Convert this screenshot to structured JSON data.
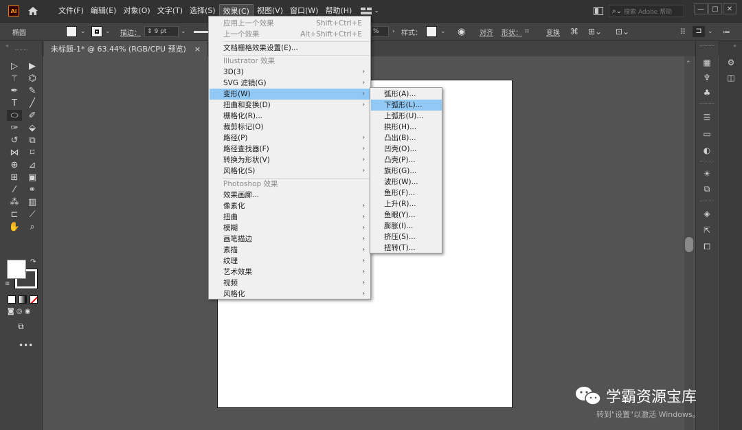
{
  "app": {
    "logo_text": "Ai"
  },
  "menubar": {
    "items": [
      "文件(F)",
      "编辑(E)",
      "对象(O)",
      "文字(T)",
      "选择(S)",
      "效果(C)",
      "视图(V)",
      "窗口(W)",
      "帮助(H)"
    ],
    "active_item": "效果(C)",
    "search_placeholder": "搜索 Adobe 帮助",
    "window_buttons": {
      "minimize": "—",
      "maximize": "□",
      "close": "✕"
    }
  },
  "controlbar": {
    "tool_name": "椭圆",
    "stroke_label": "描边：",
    "stroke_value": "9 pt",
    "opacity_value": "%",
    "style_label": "样式：",
    "align_label": "对齐",
    "shape_label": "形状：",
    "transform_label": "变换"
  },
  "document_tab": {
    "title": "未标题-1* @ 63.44% (RGB/CPU 预览)",
    "close": "×"
  },
  "effect_menu": {
    "items": [
      {
        "label": "应用上一个效果",
        "shortcut": "Shift+Ctrl+E",
        "state": "disabled"
      },
      {
        "label": "上一个效果",
        "shortcut": "Alt+Shift+Ctrl+E",
        "state": "disabled"
      },
      {
        "label": "文档栅格效果设置(E)...",
        "state": "normal"
      },
      {
        "label": "Illustrator 效果",
        "state": "header"
      },
      {
        "label": "3D(3)",
        "submenu": true
      },
      {
        "label": "SVG 滤镜(G)",
        "submenu": true
      },
      {
        "label": "变形(W)",
        "submenu": true,
        "state": "highlighted"
      },
      {
        "label": "扭曲和变换(D)",
        "submenu": true
      },
      {
        "label": "栅格化(R)...",
        "state": "normal"
      },
      {
        "label": "裁剪标记(O)",
        "state": "normal"
      },
      {
        "label": "路径(P)",
        "submenu": true
      },
      {
        "label": "路径查找器(F)",
        "submenu": true
      },
      {
        "label": "转换为形状(V)",
        "submenu": true
      },
      {
        "label": "风格化(S)",
        "submenu": true
      },
      {
        "label": "Photoshop 效果",
        "state": "header"
      },
      {
        "label": "效果画廊...",
        "state": "normal"
      },
      {
        "label": "像素化",
        "submenu": true
      },
      {
        "label": "扭曲",
        "submenu": true
      },
      {
        "label": "模糊",
        "submenu": true
      },
      {
        "label": "画笔描边",
        "submenu": true
      },
      {
        "label": "素描",
        "submenu": true
      },
      {
        "label": "纹理",
        "submenu": true
      },
      {
        "label": "艺术效果",
        "submenu": true
      },
      {
        "label": "视频",
        "submenu": true
      },
      {
        "label": "风格化",
        "submenu": true
      }
    ]
  },
  "warp_submenu": {
    "items": [
      "弧形(A)...",
      "下弧形(L)...",
      "上弧形(U)...",
      "拱形(H)...",
      "凸出(B)...",
      "凹壳(O)...",
      "凸壳(P)...",
      "旗形(G)...",
      "波形(W)...",
      "鱼形(F)...",
      "上升(R)...",
      "鱼眼(Y)...",
      "膨胀(I)...",
      "挤压(S)...",
      "扭转(T)..."
    ],
    "highlighted": "下弧形(L)..."
  },
  "watermark": {
    "brand": "学霸资源宝库",
    "activate_line": "转到\"设置\"以激活 Windows。"
  },
  "colors": {
    "accent_highlight": "#90c8f6",
    "app_bg": "#535353",
    "menubar_bg": "#323232",
    "ai_logo": "#ff9a00"
  }
}
